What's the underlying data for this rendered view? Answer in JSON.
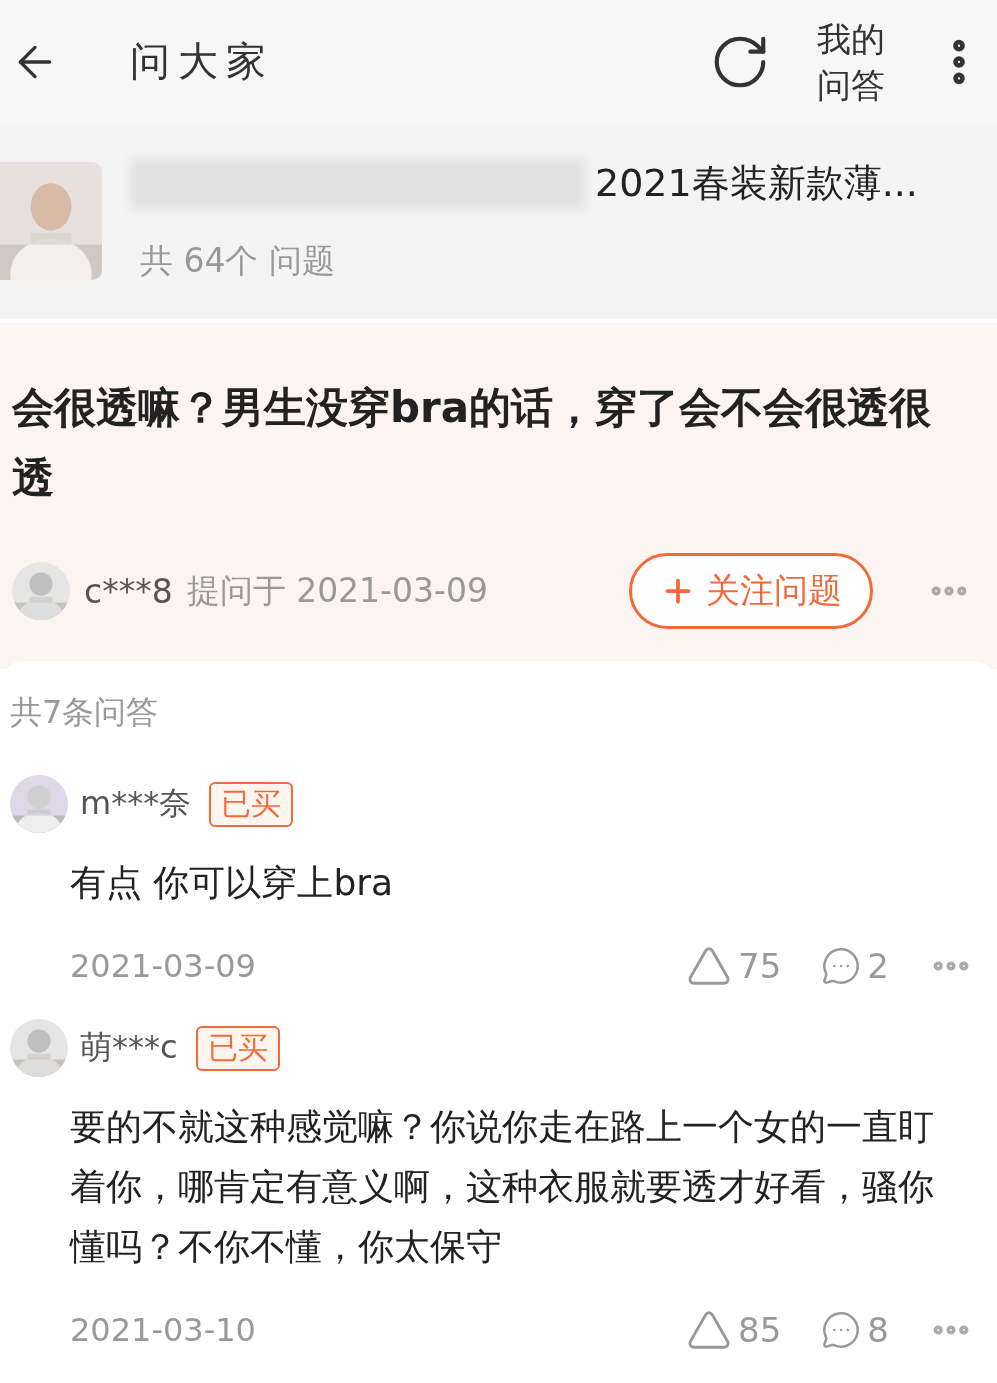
{
  "header": {
    "title": "问大家",
    "my_qa": "我的问答"
  },
  "product": {
    "name": "2021春装新款薄...",
    "count": "共 64个 问题"
  },
  "question": {
    "text": "会很透嘛？男生没穿bra的话，穿了会不会很透很透",
    "asker": "c***8",
    "asked": "提问于 2021-03-09",
    "follow": "关注问题"
  },
  "total": "共7条问答",
  "answers": [
    {
      "user": "m***奈",
      "badge": "已买",
      "text": "有点 你可以穿上bra",
      "date": "2021-03-09",
      "likes": "75",
      "comments": "2"
    },
    {
      "user": "萌***c",
      "badge": "已买",
      "text": "要的不就这种感觉嘛？你说你走在路上一个女的一直盯着你，哪肯定有意义啊，这种衣服就要透才好看，骚你懂吗？不你不懂，你太保守",
      "date": "2021-03-10",
      "likes": "85",
      "comments": "8"
    }
  ]
}
